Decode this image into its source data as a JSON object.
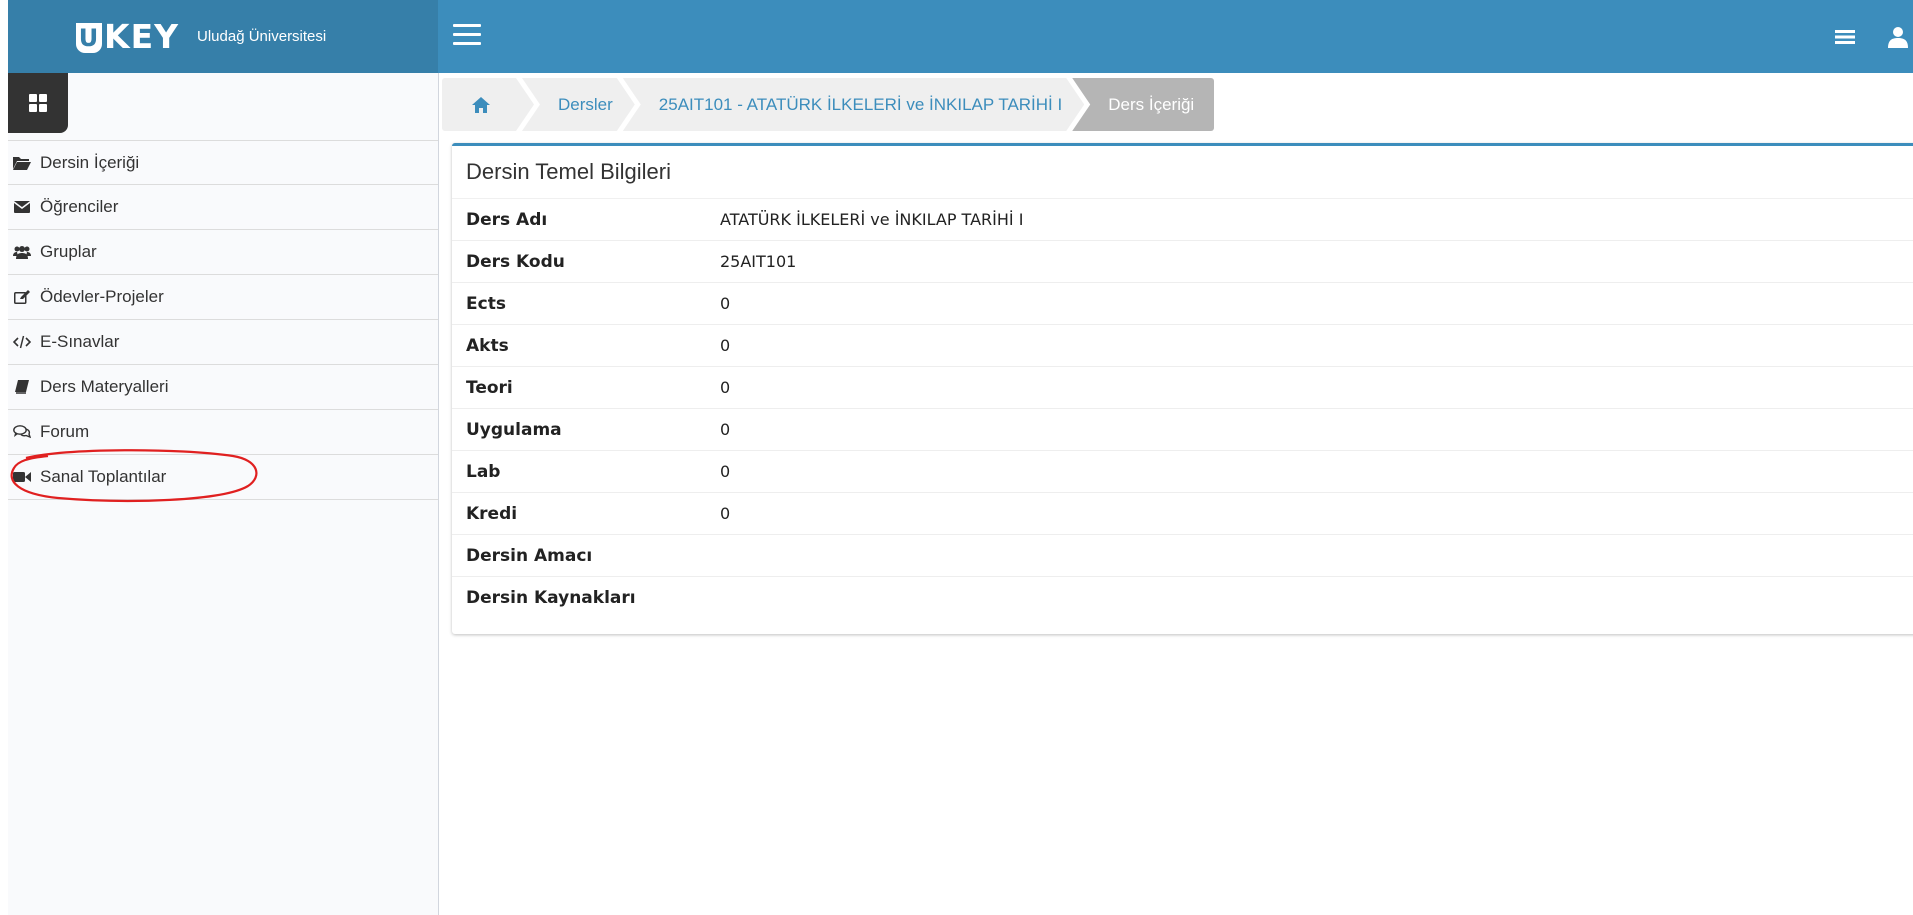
{
  "header": {
    "logo_text": "KEY",
    "logo_u": "U",
    "university": "Uludağ Üniversitesi"
  },
  "sidebar": {
    "items": [
      {
        "label": "Dersin İçeriği",
        "icon": "folder-open-icon"
      },
      {
        "label": "Öğrenciler",
        "icon": "envelope-icon"
      },
      {
        "label": "Gruplar",
        "icon": "users-icon"
      },
      {
        "label": "Ödevler-Projeler",
        "icon": "edit-icon"
      },
      {
        "label": "E-Sınavlar",
        "icon": "code-icon"
      },
      {
        "label": "Ders Materyalleri",
        "icon": "book-icon"
      },
      {
        "label": "Forum",
        "icon": "comments-icon"
      },
      {
        "label": "Sanal Toplantılar",
        "icon": "video-camera-icon"
      }
    ],
    "annotation_color": "#e02020"
  },
  "breadcrumb": {
    "home_icon": "home-icon",
    "items": [
      "Dersler",
      "25AIT101 - ATATÜRK İLKELERİ ve İNKILAP TARİHİ I"
    ],
    "active": "Ders İçeriği"
  },
  "panel": {
    "title": "Dersin Temel Bilgileri",
    "rows": [
      {
        "key": "Ders Adı",
        "value": "ATATÜRK İLKELERİ ve İNKILAP TARİHİ I"
      },
      {
        "key": "Ders Kodu",
        "value": "25AIT101"
      },
      {
        "key": "Ects",
        "value": "0"
      },
      {
        "key": "Akts",
        "value": "0"
      },
      {
        "key": "Teori",
        "value": "0"
      },
      {
        "key": "Uygulama",
        "value": "0"
      },
      {
        "key": "Lab",
        "value": "0"
      },
      {
        "key": "Kredi",
        "value": "0"
      },
      {
        "key": "Dersin Amacı",
        "value": ""
      },
      {
        "key": "Dersin Kaynakları",
        "value": ""
      }
    ]
  },
  "colors": {
    "topbar": "#3c8dbc",
    "brand": "#367fa9",
    "link": "#3c8dbc"
  }
}
